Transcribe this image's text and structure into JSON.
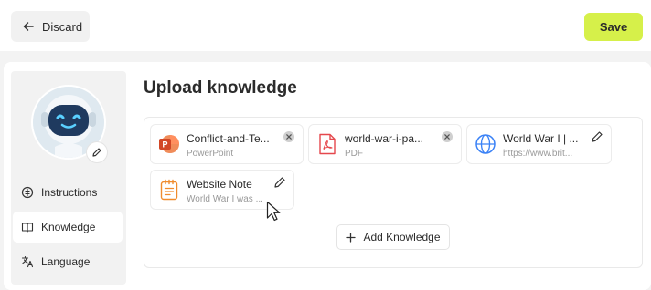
{
  "header": {
    "discard_label": "Discard",
    "save_label": "Save"
  },
  "sidebar": {
    "items": [
      {
        "label": "Instructions",
        "icon": "instructions-icon"
      },
      {
        "label": "Knowledge",
        "icon": "book-icon",
        "active": true
      },
      {
        "label": "Language",
        "icon": "translate-icon"
      }
    ]
  },
  "main": {
    "title": "Upload knowledge",
    "files": [
      {
        "name": "Conflict-and-Te...",
        "type": "PowerPoint",
        "icon": "powerpoint-icon",
        "action": "remove"
      },
      {
        "name": "world-war-i-pa...",
        "type": "PDF",
        "icon": "pdf-icon",
        "action": "remove"
      },
      {
        "name": "World War I | ...",
        "type": "https://www.brit...",
        "icon": "globe-icon",
        "action": "edit"
      },
      {
        "name": "Website Note",
        "type": "World War I was ...",
        "icon": "note-icon",
        "action": "edit"
      }
    ],
    "add_label": "Add Knowledge"
  },
  "colors": {
    "accent": "#d6f04a",
    "powerpoint": "#d24726",
    "pdf": "#e5484d",
    "globe": "#3b82f6",
    "note": "#f08c2e"
  }
}
